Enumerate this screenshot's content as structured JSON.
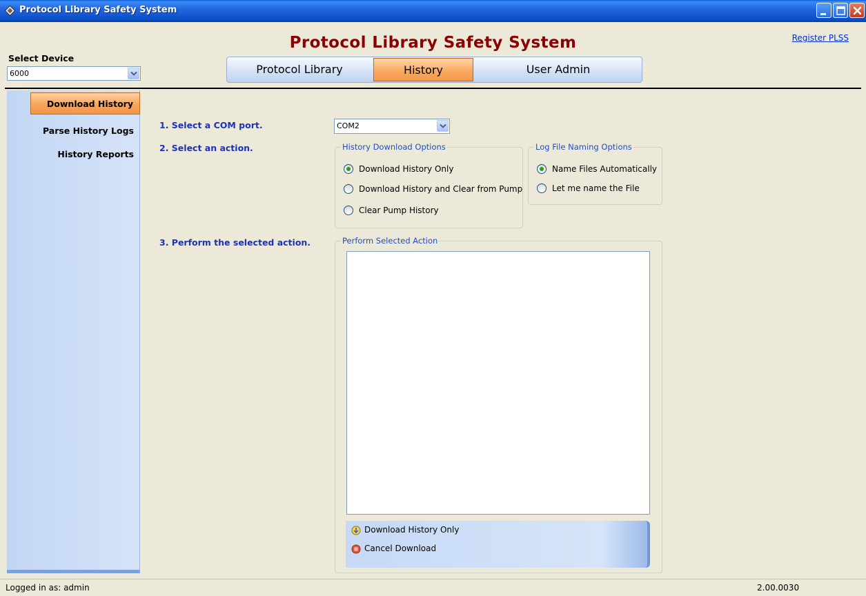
{
  "window": {
    "title": "Protocol Library Safety System"
  },
  "header": {
    "app_title": "Protocol Library Safety System",
    "register_link": "Register PLSS",
    "device_label": "Select Device",
    "device_value": "6000",
    "tabs": [
      "Protocol Library",
      "History",
      "User Admin"
    ],
    "active_tab": "History"
  },
  "sidebar": {
    "items": [
      "Download History",
      "Parse History Logs",
      "History Reports"
    ],
    "active_item": "Download History"
  },
  "main": {
    "steps": [
      "1. Select a COM port.",
      "2. Select an action.",
      "3. Perform the selected action."
    ],
    "com_port": "COM2",
    "history_options": {
      "legend": "History Download Options",
      "options": [
        "Download History Only",
        "Download History and Clear from Pump",
        "Clear Pump History"
      ],
      "selected": "Download History Only"
    },
    "naming_options": {
      "legend": "Log File Naming Options",
      "options": [
        "Name Files Automatically",
        "Let me name the File"
      ],
      "selected": "Name Files Automatically"
    },
    "perform": {
      "legend": "Perform Selected Action",
      "output_text": "",
      "actions": [
        "Download History Only",
        "Cancel Download"
      ]
    }
  },
  "statusbar": {
    "user": "Logged in as: admin",
    "version": "2.00.0030"
  },
  "colors": {
    "accent_orange": "#f9a85c",
    "title_red": "#8b0000",
    "step_blue": "#1a33b8",
    "sidebar_blue": "#c8dbf6"
  }
}
